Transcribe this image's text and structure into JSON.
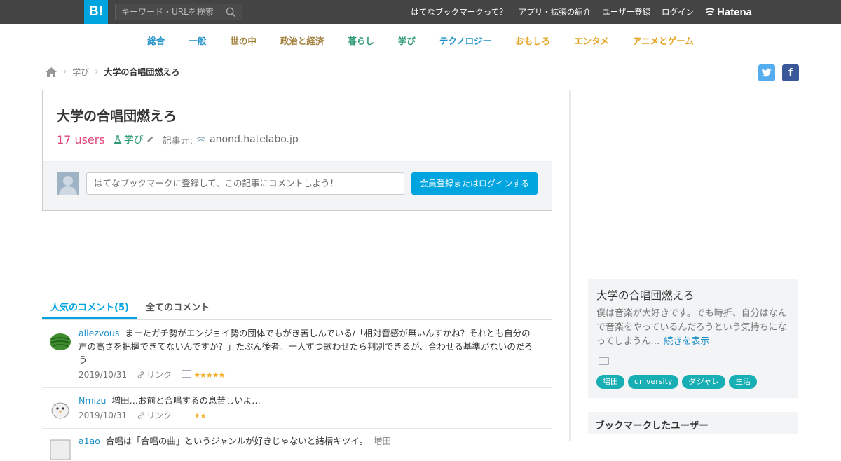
{
  "topbar": {
    "logo": "B!",
    "search_placeholder": "キーワード・URLを検索",
    "links": [
      "はてなブックマークって？",
      "アプリ・拡張の紹介",
      "ユーザー登録",
      "ログイン"
    ],
    "brand": "Hatena",
    "accent": "#00a4de"
  },
  "categories": [
    {
      "label": "総合",
      "color": "#1d8fc8"
    },
    {
      "label": "一般",
      "color": "#1d8fc8"
    },
    {
      "label": "世の中",
      "color": "#a3823f"
    },
    {
      "label": "政治と経済",
      "color": "#a3823f"
    },
    {
      "label": "暮らし",
      "color": "#2d9a71"
    },
    {
      "label": "学び",
      "color": "#2d9a71"
    },
    {
      "label": "テクノロジー",
      "color": "#1d8fc8"
    },
    {
      "label": "おもしろ",
      "color": "#e5a423"
    },
    {
      "label": "エンタメ",
      "color": "#e5a423"
    },
    {
      "label": "アニメとゲーム",
      "color": "#e5a423"
    }
  ],
  "breadcrumb": {
    "category": "学び",
    "current": "大学の合唱団燃えろ"
  },
  "social": {
    "twitter": "t",
    "facebook": "f"
  },
  "entry": {
    "title": "大学の合唱団燃えろ",
    "users": "17 users",
    "category": "学び",
    "source_label": "記事元:",
    "source_domain": "anond.hatelabo.jp",
    "comment_placeholder": "はてなブックマークに登録して、この記事にコメントしよう！",
    "login_button": "会員登録またはログインする"
  },
  "tabs": {
    "popular": "人気のコメント(5)",
    "all": "全てのコメント"
  },
  "comments": [
    {
      "user": "allezvous",
      "text": "まーたガチ勢がエンジョイ勢の団体でもがき苦しんでいる/「相対音感が無いんすかね？それとも自分の声の高さを把握できてないんですか？」たぶん後者。一人ずつ歌わせたら判別できるが、合わせる基準がないのだろう",
      "date": "2019/10/31",
      "link_label": "リンク",
      "stars": "★★★★★"
    },
    {
      "user": "Nmizu",
      "text": "増田…お前と合唱するの息苦しいよ…",
      "date": "2019/10/31",
      "link_label": "リンク",
      "stars": "★★"
    },
    {
      "user": "a1ao",
      "text": "合唱は「合唱の曲」というジャンルが好きじゃないと結構キツイ。",
      "date": "",
      "link_label": "増田",
      "stars": ""
    }
  ],
  "sidebar": {
    "title": "大学の合唱団燃えろ",
    "description": "僕は音楽が大好きです。でも時折、自分はなんで音楽をやっているんだろうという気持ちになってしまうん…",
    "more": "続きを表示",
    "tags": [
      "増田",
      "university",
      "ダジャレ",
      "生活"
    ],
    "users_heading": "ブックマークしたユーザー"
  }
}
